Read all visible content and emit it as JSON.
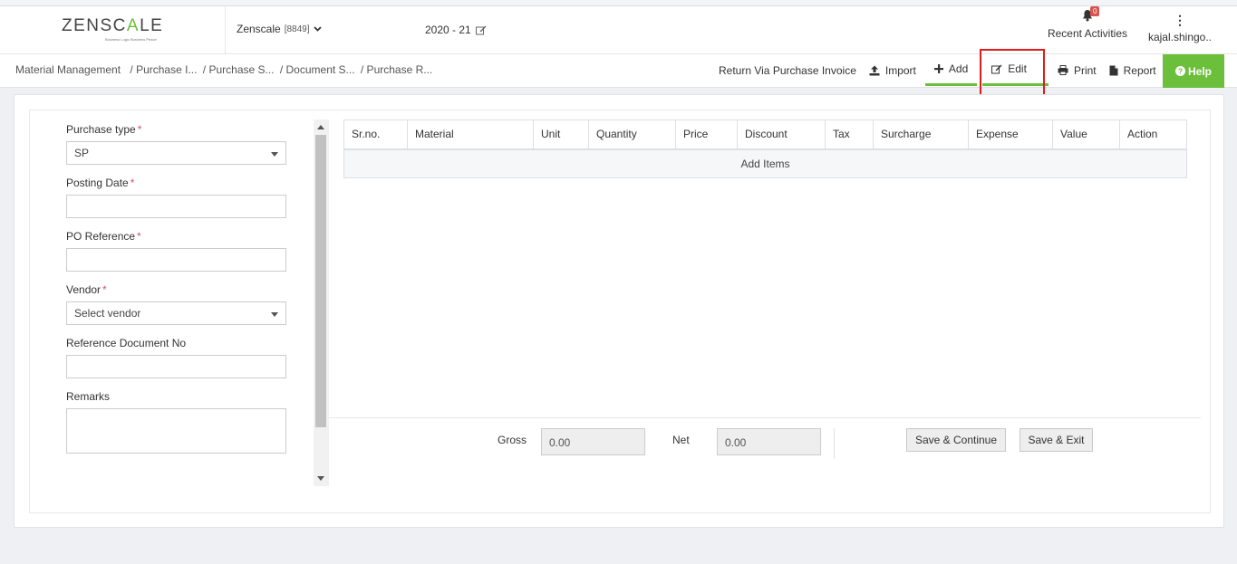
{
  "header": {
    "logo": {
      "prefix": "ZENSC",
      "accent": "A",
      "suffix": "LE",
      "tagline": "Business Logic Business Peace"
    },
    "company": {
      "name": "Zenscale",
      "code": "[8849]"
    },
    "fiscal_year": "2020 - 21",
    "notifications": {
      "count": "0",
      "label": "Recent Activities"
    },
    "user": {
      "name": "kajal.shingo.."
    }
  },
  "breadcrumb": [
    "Material Management",
    "/ Purchase I...",
    "/ Purchase S...",
    "/ Document S...",
    "/ Purchase R..."
  ],
  "toolbar": {
    "return_label": "Return Via Purchase Invoice",
    "import_label": "Import",
    "add_label": "Add",
    "edit_label": "Edit",
    "print_label": "Print",
    "report_label": "Report",
    "help_label": "Help"
  },
  "form": {
    "purchase_type": {
      "label": "Purchase type",
      "value": "SP"
    },
    "posting_date": {
      "label": "Posting Date",
      "value": ""
    },
    "po_reference": {
      "label": "PO Reference",
      "value": ""
    },
    "vendor": {
      "label": "Vendor",
      "value": "Select vendor"
    },
    "reference_doc": {
      "label": "Reference Document No",
      "value": ""
    },
    "remarks": {
      "label": "Remarks",
      "value": ""
    }
  },
  "table": {
    "columns": [
      "Sr.no.",
      "Material",
      "Unit",
      "Quantity",
      "Price",
      "Discount",
      "Tax",
      "Surcharge",
      "Expense",
      "Value",
      "Action"
    ],
    "add_items_label": "Add Items"
  },
  "totals": {
    "gross_label": "Gross",
    "gross_value": "0.00",
    "net_label": "Net",
    "net_value": "0.00"
  },
  "buttons": {
    "save_continue": "Save & Continue",
    "save_exit": "Save & Exit"
  },
  "colors": {
    "accent": "#6bbf3a",
    "highlight": "#e21b1b",
    "badge": "#d9534f"
  }
}
